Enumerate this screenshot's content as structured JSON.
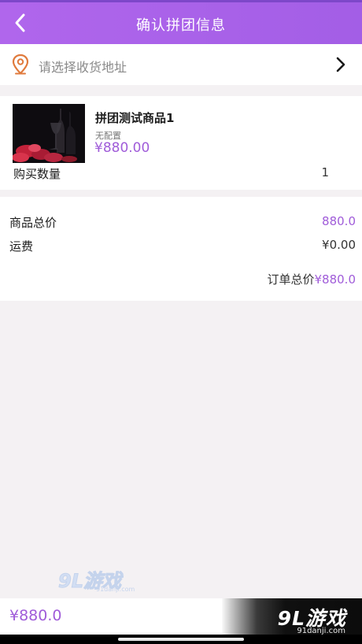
{
  "header": {
    "title": "确认拼团信息",
    "back_icon": "chevron-left-icon"
  },
  "address": {
    "placeholder": "请选择收货地址",
    "pin_icon": "location-pin-icon",
    "chevron_icon": "chevron-right-icon"
  },
  "product": {
    "name": "拼团测试商品1",
    "spec": "无配置",
    "price": "¥880.00",
    "qty_label": "购买数量",
    "qty_value": "1"
  },
  "summary": {
    "goods_total_label": "商品总价",
    "goods_total_value": "880.0",
    "shipping_label": "运费",
    "shipping_value": "¥0.00",
    "order_total_label": "订单总价",
    "order_total_value": "¥880.0"
  },
  "footer": {
    "price": "¥880.0",
    "brand_logo": "9L游戏",
    "brand_url": "91danji.com"
  },
  "watermark": {
    "logo": "9L游戏",
    "url": "91danji.com"
  },
  "colors": {
    "accent": "#a05cd9",
    "header": "#ab62ea",
    "pin": "#e07a3c"
  }
}
